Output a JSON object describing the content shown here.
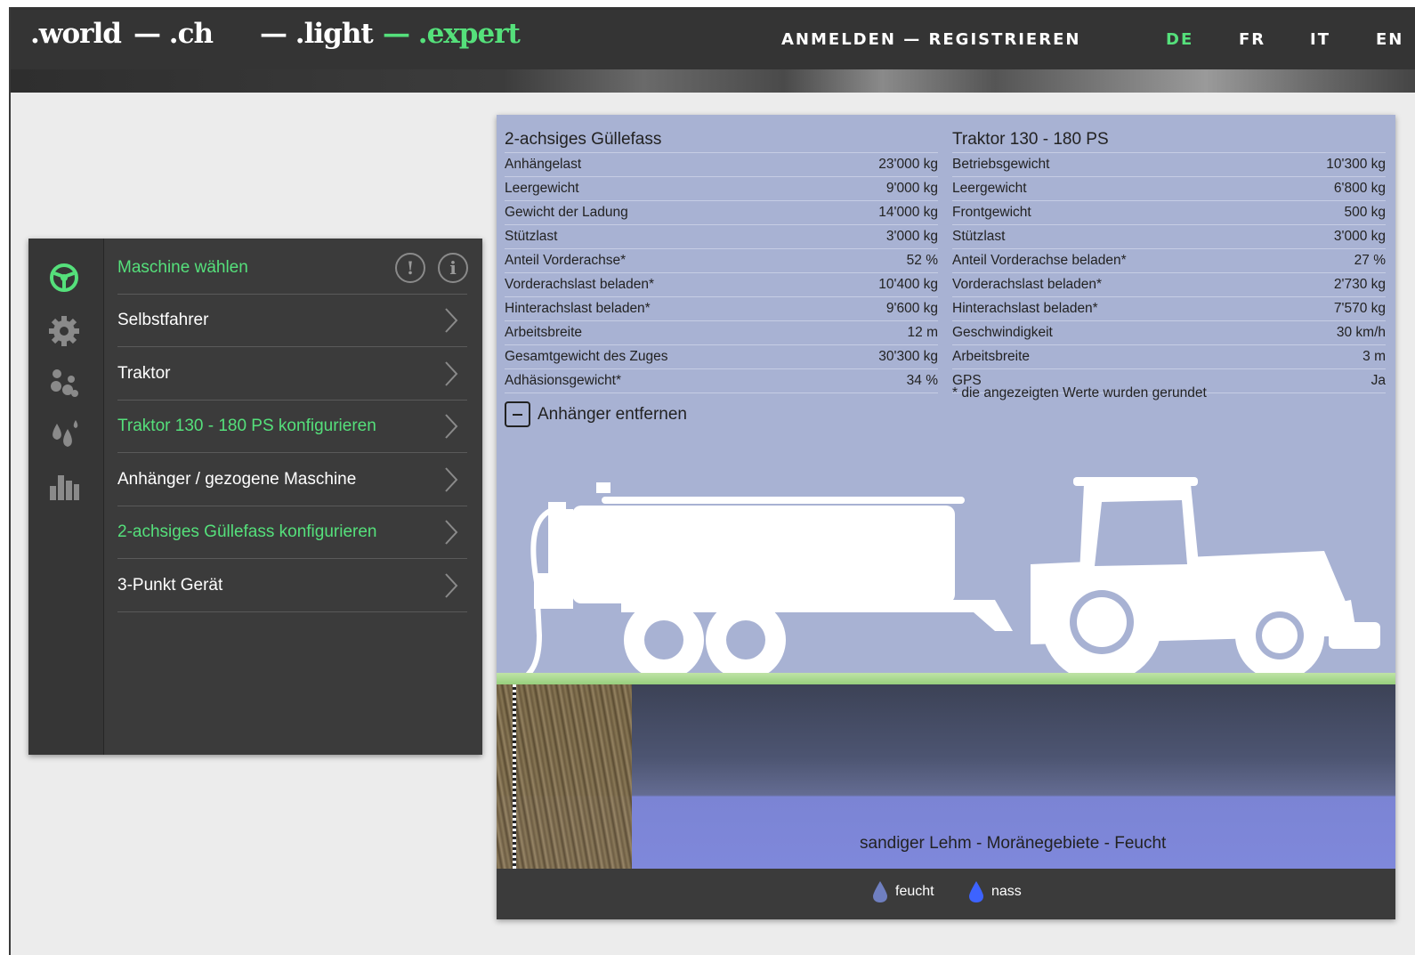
{
  "header": {
    "logos": [
      ".world",
      "— .ch",
      "— .light",
      "— .expert"
    ],
    "auth": "ANMELDEN — REGISTRIEREN",
    "languages": [
      "DE",
      "FR",
      "IT",
      "EN"
    ],
    "active_language": "DE"
  },
  "sidebar": {
    "icons": [
      "steering-wheel-icon",
      "gear-icon",
      "seeds-icon",
      "drops-icon",
      "bar-chart-icon"
    ],
    "menu": [
      {
        "label": "Maschine wählen",
        "highlight": true
      },
      {
        "label": "Selbstfahrer",
        "highlight": false
      },
      {
        "label": "Traktor",
        "highlight": false
      },
      {
        "label": "Traktor 130 - 180 PS konfigurieren",
        "highlight": true
      },
      {
        "label": "Anhänger / gezogene Maschine",
        "highlight": false
      },
      {
        "label": "2-achsiges Güllefass konfigurieren",
        "highlight": true
      },
      {
        "label": "3-Punkt Gerät",
        "highlight": false
      }
    ],
    "hint_button": "!",
    "info_button": "i"
  },
  "trailer_table": {
    "title": "2-achsiges Güllefass",
    "rows": [
      {
        "label": "Anhängelast",
        "value": "23'000 kg"
      },
      {
        "label": "Leergewicht",
        "value": "9'000 kg"
      },
      {
        "label": "Gewicht der Ladung",
        "value": "14'000 kg"
      },
      {
        "label": "Stützlast",
        "value": "3'000 kg"
      },
      {
        "label": "Anteil Vorderachse*",
        "value": "52 %"
      },
      {
        "label": "Vorderachslast beladen*",
        "value": "10'400 kg"
      },
      {
        "label": "Hinterachslast beladen*",
        "value": "9'600 kg"
      },
      {
        "label": "Arbeitsbreite",
        "value": "12 m"
      },
      {
        "label": "Gesamtgewicht des Zuges",
        "value": "30'300 kg"
      },
      {
        "label": "Adhäsionsgewicht*",
        "value": "34 %"
      }
    ]
  },
  "tractor_table": {
    "title": "Traktor 130 - 180 PS",
    "rows": [
      {
        "label": "Betriebsgewicht",
        "value": "10'300 kg"
      },
      {
        "label": "Leergewicht",
        "value": "6'800 kg"
      },
      {
        "label": "Frontgewicht",
        "value": "500 kg"
      },
      {
        "label": "Stützlast",
        "value": "3'000 kg"
      },
      {
        "label": "Anteil Vorderachse beladen*",
        "value": "27 %"
      },
      {
        "label": "Vorderachslast beladen*",
        "value": "2'730 kg"
      },
      {
        "label": "Hinterachslast beladen*",
        "value": "7'570 kg"
      },
      {
        "label": "Geschwindigkeit",
        "value": "30 km/h"
      },
      {
        "label": "Arbeitsbreite",
        "value": "3 m"
      },
      {
        "label": "GPS",
        "value": "Ja"
      }
    ]
  },
  "footnote": "* die angezeigten Werte wurden gerundet",
  "remove_trailer": "Anhänger entfernen",
  "soil_label": "sandiger Lehm - Moränegebiete - Feucht",
  "legend": [
    {
      "label": "feucht",
      "color": "#6f7fc0"
    },
    {
      "label": "nass",
      "color": "#3d63ff"
    }
  ],
  "colors": {
    "accent": "#55e07b",
    "panel": "#a8b2d3",
    "dark": "#3b3b3b"
  }
}
